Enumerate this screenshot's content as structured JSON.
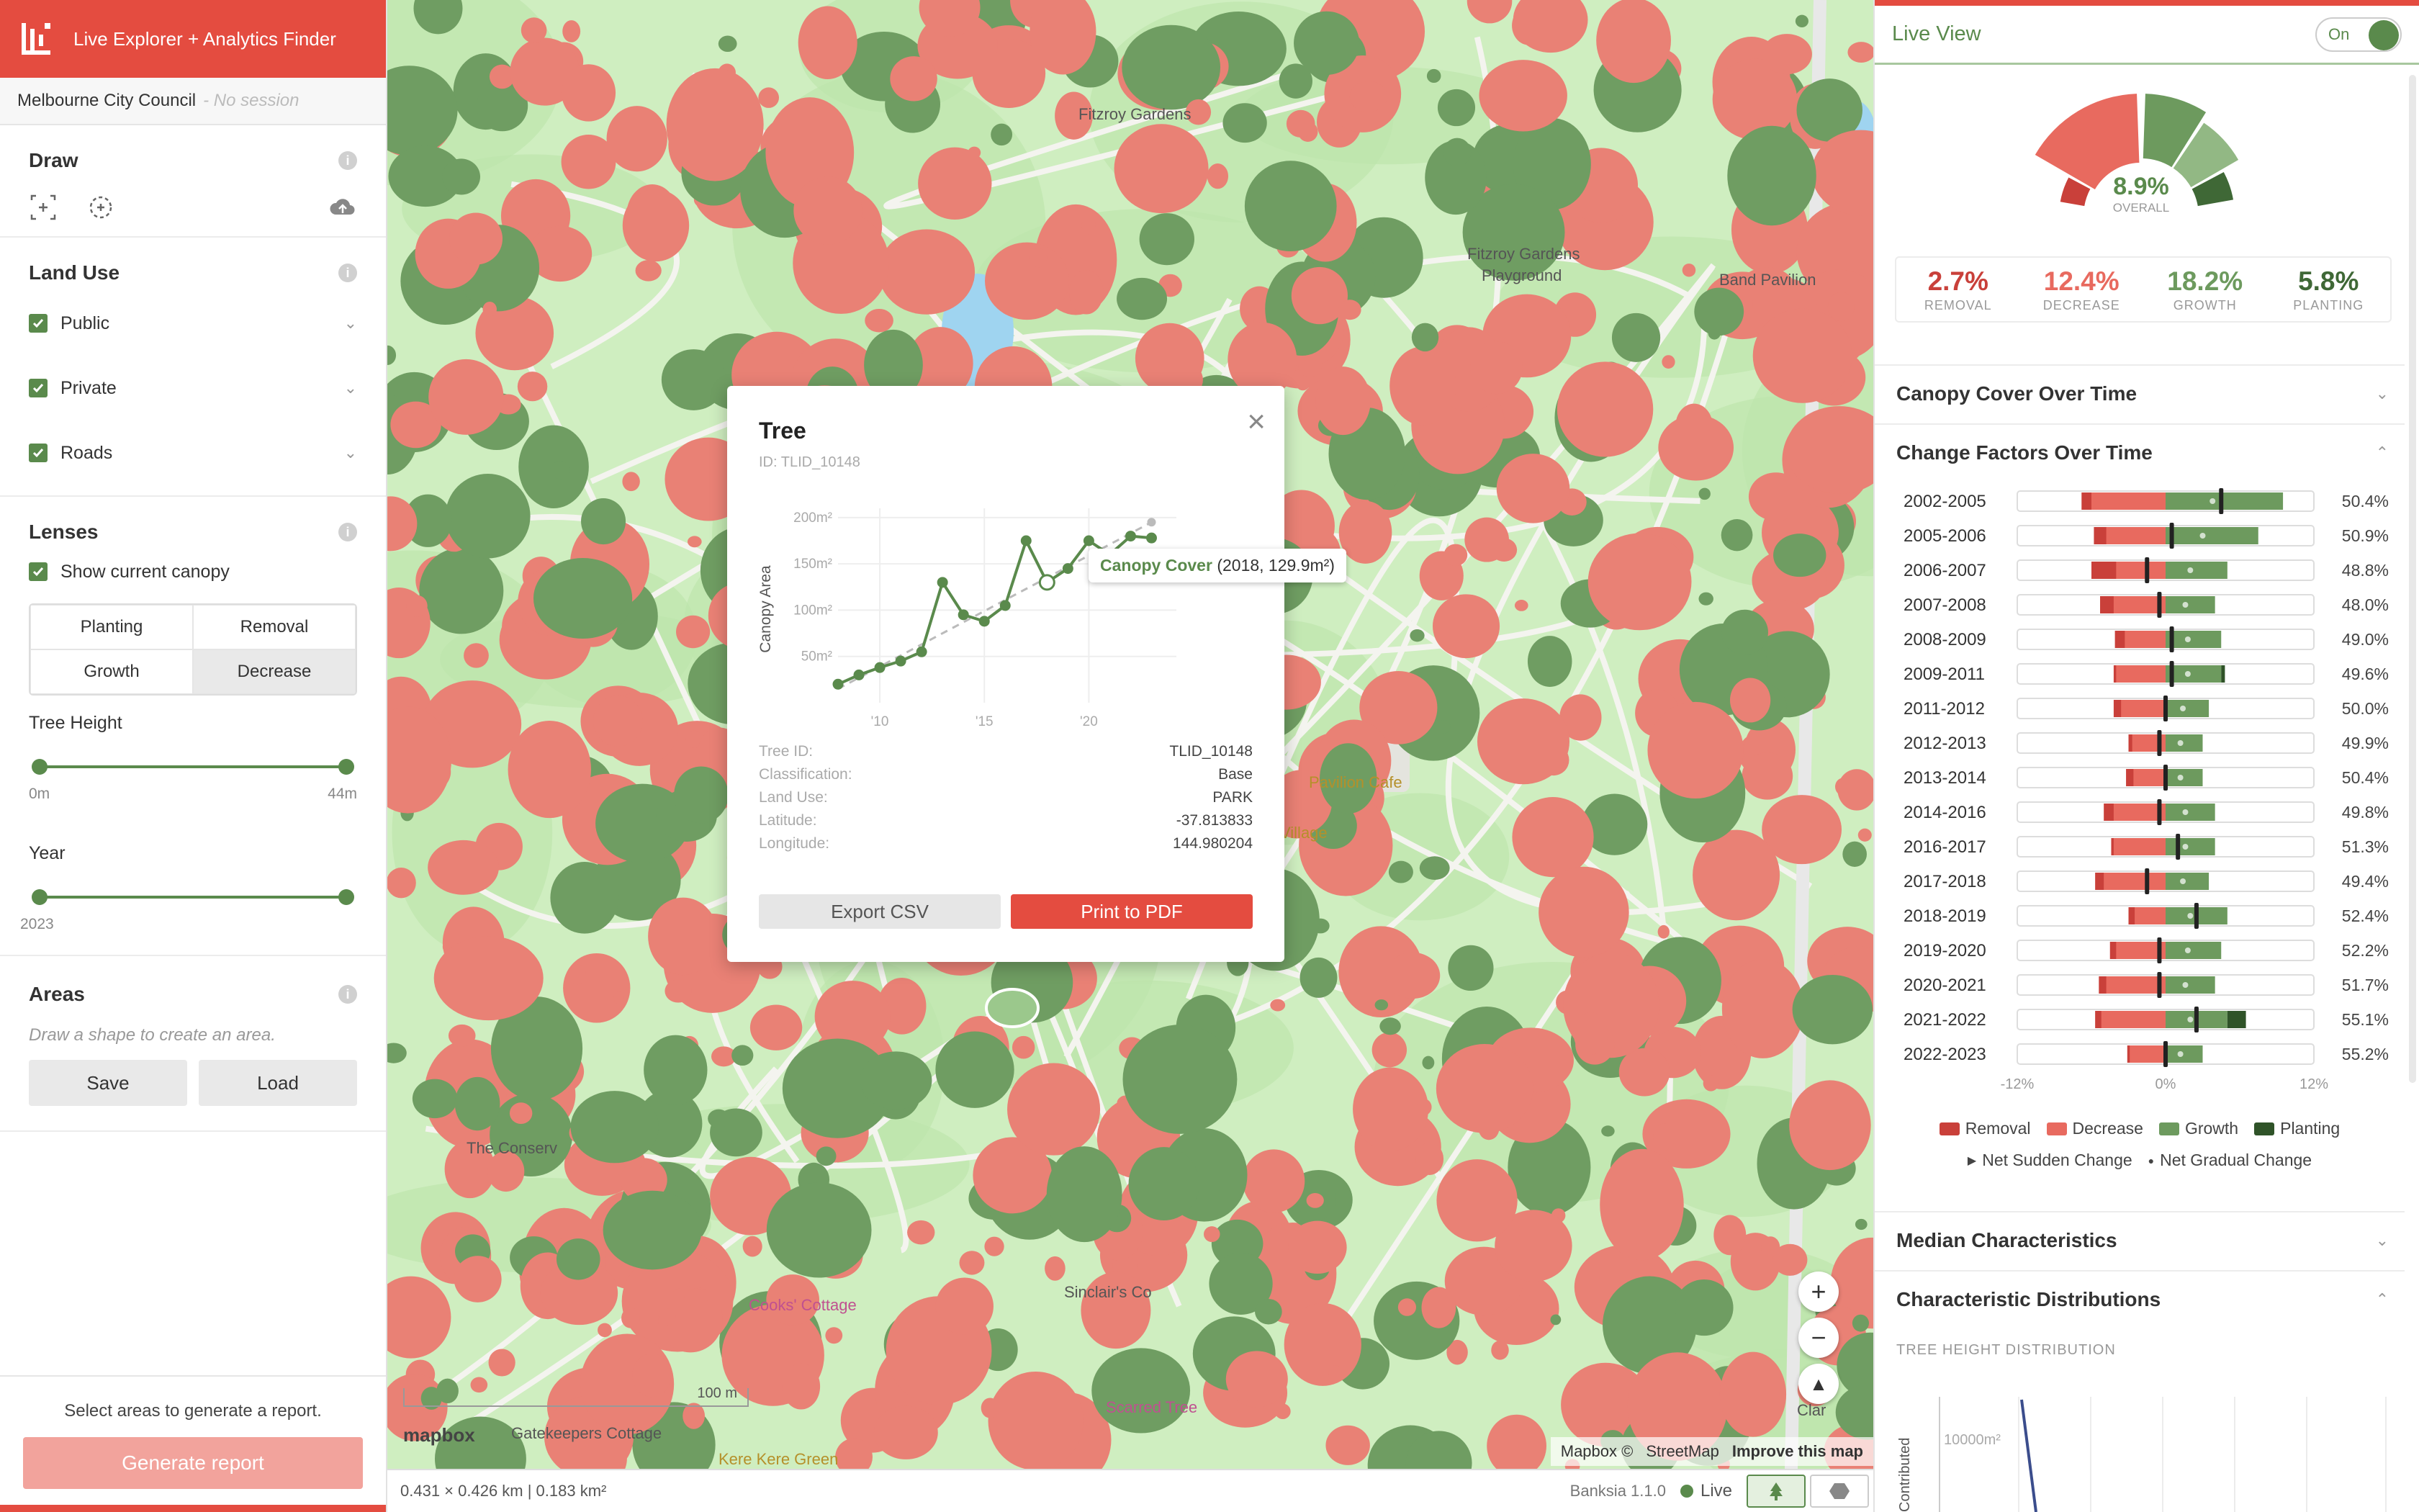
{
  "app": {
    "title": "Live Explorer + Analytics Finder",
    "org": "Melbourne City Council",
    "session": "- No session"
  },
  "left": {
    "draw": {
      "title": "Draw"
    },
    "land_use": {
      "title": "Land Use",
      "items": [
        "Public",
        "Private",
        "Roads"
      ]
    },
    "lenses": {
      "title": "Lenses",
      "show_canopy": "Show current canopy",
      "buttons": [
        "Planting",
        "Removal",
        "Growth",
        "Decrease"
      ],
      "selected": "Decrease"
    },
    "tree_height": {
      "label": "Tree Height",
      "min": "0m",
      "max": "44m"
    },
    "year": {
      "label": "Year",
      "value": "2023"
    },
    "areas": {
      "title": "Areas",
      "hint": "Draw a shape to create an area.",
      "save": "Save",
      "load": "Load"
    },
    "report": {
      "hint": "Select areas to generate a report.",
      "button": "Generate report"
    }
  },
  "map": {
    "labels": {
      "fitzroy_gardens": "Fitzroy Gardens",
      "playground_1": "Fitzroy Gardens",
      "playground_2": "Playground",
      "band_pavilion": "Band Pavilion",
      "pavilion_cafe": "Pavilion Cafe",
      "village": "Village",
      "conservatory": "The Conserv",
      "cooks_cottage": "Cooks' Cottage",
      "sinclair": "Sinclair's Co",
      "scarred_tree": "Scarred Tree",
      "gatekeepers": "Gatekeepers Cottage",
      "kere_kere": "Kere Kere Green",
      "clar": "Clar"
    },
    "scale": "100 m",
    "footer_dims": "0.431 × 0.426 km | 0.183 km²",
    "version": "Banksia 1.1.0",
    "live": "Live",
    "attribution": {
      "mapbox": "Mapbox ©",
      "osm": "StreetMap",
      "improve": "Improve this map"
    },
    "mapbox_logo": "mapbox",
    "zoom_in": "+",
    "zoom_out": "−"
  },
  "popup": {
    "title": "Tree",
    "id": "ID: TLID_10148",
    "close": "×",
    "chart": {
      "ylabel": "Canopy Area",
      "yticks": [
        "200m²",
        "150m²",
        "100m²",
        "50m²"
      ],
      "xticks": [
        "'10",
        "'15",
        "'20"
      ],
      "tooltip_series": "Canopy Cover",
      "tooltip_value": "(2018, 129.9m²)"
    },
    "fields": [
      {
        "k": "Tree ID:",
        "v": "TLID_10148"
      },
      {
        "k": "Classification:",
        "v": "Base"
      },
      {
        "k": "Land Use:",
        "v": "PARK"
      },
      {
        "k": "Latitude:",
        "v": "-37.813833"
      },
      {
        "k": "Longitude:",
        "v": "144.980204"
      }
    ],
    "export_csv": "Export CSV",
    "print_pdf": "Print to PDF"
  },
  "right": {
    "title": "Live View",
    "toggle": "On",
    "overall_value": "8.9%",
    "overall_label": "OVERALL",
    "stats": [
      {
        "value": "2.7%",
        "label": "REMOVAL",
        "color": "#c9403a"
      },
      {
        "value": "12.4%",
        "label": "DECREASE",
        "color": "#e86a5f"
      },
      {
        "value": "18.2%",
        "label": "GROWTH",
        "color": "#6d9a5e"
      },
      {
        "value": "5.8%",
        "label": "PLANTING",
        "color": "#3f6836"
      }
    ],
    "sections": {
      "canopy_cover": "Canopy Cover Over Time",
      "change_factors": "Change Factors Over Time",
      "median": "Median Characteristics",
      "distributions": "Characteristic Distributions"
    },
    "cf_axis": [
      "-12%",
      "0%",
      "12%"
    ],
    "legend": [
      "Removal",
      "Decrease",
      "Growth",
      "Planting"
    ],
    "legend2": [
      "Net Sudden Change",
      "Net Gradual Change"
    ],
    "tree_height_dist": "TREE HEIGHT DISTRIBUTION",
    "dist_ytick": "10000m²",
    "dist_ylabel": "Contributed",
    "colors": {
      "removal": "#c9403a",
      "decrease": "#e86a5f",
      "growth": "#6d9a5e",
      "planting": "#2f5328"
    }
  },
  "chart_data": [
    {
      "type": "line",
      "ylabel": "Canopy Area",
      "x": [
        2008,
        2009,
        2010,
        2011,
        2012,
        2013,
        2014,
        2015,
        2016,
        2017,
        2018,
        2019,
        2020,
        2021,
        2022,
        2023
      ],
      "series": [
        {
          "name": "Canopy Cover",
          "values": [
            20,
            30,
            38,
            45,
            55,
            130,
            95,
            88,
            105,
            175,
            130,
            145,
            175,
            160,
            180,
            178
          ]
        }
      ],
      "ylim": [
        0,
        210
      ]
    },
    {
      "type": "bar",
      "title": "Change Factors Over Time",
      "categories": [
        "2002-2005",
        "2005-2006",
        "2006-2007",
        "2007-2008",
        "2008-2009",
        "2009-2011",
        "2011-2012",
        "2012-2013",
        "2013-2014",
        "2014-2016",
        "2016-2017",
        "2017-2018",
        "2018-2019",
        "2019-2020",
        "2020-2021",
        "2021-2022",
        "2022-2023"
      ],
      "labels": [
        "50.4%",
        "50.9%",
        "48.8%",
        "48.0%",
        "49.0%",
        "49.6%",
        "50.0%",
        "49.9%",
        "50.4%",
        "49.8%",
        "51.3%",
        "49.4%",
        "52.4%",
        "52.2%",
        "51.7%",
        "55.1%",
        "55.2%"
      ],
      "series": [
        {
          "name": "Removal",
          "values": [
            -6.8,
            -5.8,
            -6.0,
            -5.3,
            -4.1,
            -4.2,
            -4.2,
            -3.0,
            -3.2,
            -5.0,
            -4.4,
            -5.7,
            -3.0,
            -4.5,
            -5.4,
            -5.7,
            -3.1
          ]
        },
        {
          "name": "Decrease",
          "values": [
            -6.0,
            -4.8,
            -4.0,
            -4.2,
            -3.3,
            -4.0,
            -3.6,
            -2.7,
            -2.6,
            -4.2,
            -4.2,
            -5.0,
            -2.5,
            -4.0,
            -4.8,
            -5.2,
            -2.9
          ]
        },
        {
          "name": "Growth",
          "values": [
            9.5,
            7.5,
            5.0,
            4.0,
            4.5,
            4.5,
            3.5,
            3.0,
            3.0,
            4.0,
            4.0,
            3.5,
            5.0,
            4.5,
            4.0,
            5.0,
            3.0
          ]
        },
        {
          "name": "Planting",
          "values": [
            0,
            0,
            0,
            0,
            0,
            0.3,
            0,
            0,
            0,
            0,
            0,
            0,
            0,
            0,
            0,
            1.5,
            0
          ]
        }
      ],
      "net_gradual": [
        4.5,
        0.5,
        -1.5,
        -0.5,
        0.5,
        0.5,
        0,
        -0.5,
        0,
        -0.5,
        1,
        -1.5,
        2.5,
        -0.5,
        -0.5,
        2.5,
        0
      ],
      "xlim": [
        -12,
        12
      ]
    },
    {
      "type": "pie",
      "title": "Live View",
      "categories": [
        "Removal",
        "Decrease",
        "Growth",
        "Planting"
      ],
      "values": [
        2.7,
        12.4,
        18.2,
        5.8
      ]
    }
  ]
}
